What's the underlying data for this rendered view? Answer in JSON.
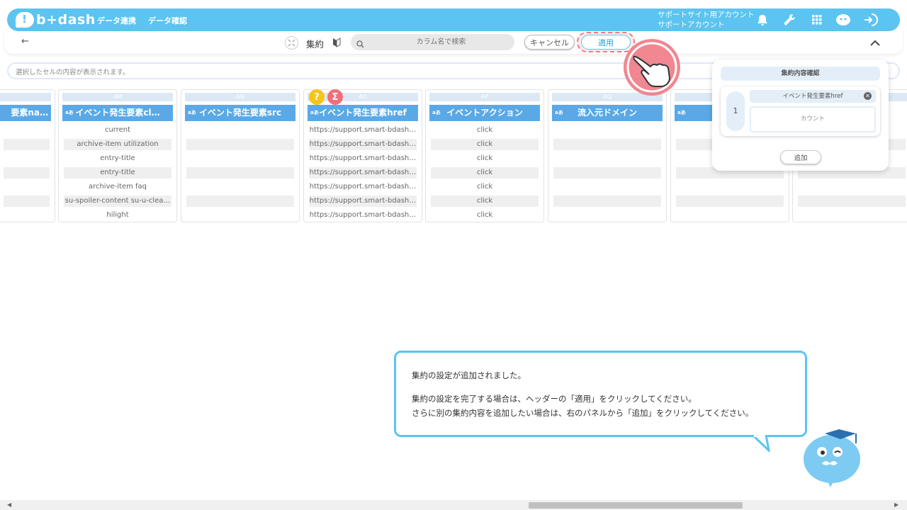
{
  "brand": {
    "logo_text": "b+dash"
  },
  "nav": {
    "links": [
      "データ連携",
      "データ確認"
    ],
    "account_line1": "サポートサイト用アカウント",
    "account_line2": "サポートアカウント"
  },
  "toolbar": {
    "back_glyph": "←",
    "aggregate_label": "集約",
    "search_placeholder": "カラム名で検索",
    "cancel_label": "キャンセル",
    "apply_label": "適用",
    "collapse_glyph": "^"
  },
  "cell_bar": {
    "text": "選択したセルの内容が表示されます。"
  },
  "columns": [
    {
      "letter": "",
      "type": "",
      "header": "要素na…",
      "cells": [
        "",
        "",
        "",
        "",
        "",
        "",
        ""
      ]
    },
    {
      "letter": "AM",
      "type": "aあ",
      "header": "イベント発生要素cl…",
      "cells": [
        "current",
        "archive-item utilization",
        "entry-title",
        "entry-title",
        "archive-item faq",
        "su-spoiler-content su-u-clea…",
        "hilight"
      ]
    },
    {
      "letter": "AN",
      "type": "aあ",
      "header": "イベント発生要素src",
      "cells": [
        "",
        "",
        "",
        "",
        "",
        "",
        ""
      ]
    },
    {
      "letter": "AO",
      "type": "aあ",
      "header": "イベント発生要素href",
      "cells": [
        "https://support.smart-bdash…",
        "https://support.smart-bdash…",
        "https://support.smart-bdash…",
        "https://support.smart-bdash…",
        "https://support.smart-bdash…",
        "https://support.smart-bdash…",
        "https://support.smart-bdash…"
      ]
    },
    {
      "letter": "AP",
      "type": "aあ",
      "header": "イベントアクション",
      "cells": [
        "click",
        "click",
        "click",
        "click",
        "click",
        "click",
        "click"
      ]
    },
    {
      "letter": "AQ",
      "type": "aあ",
      "header": "流入元ドメイン",
      "cells": [
        "",
        "",
        "",
        "",
        "",
        "",
        ""
      ]
    },
    {
      "letter": "",
      "type": "aあ",
      "header": "流",
      "cells": [
        "",
        "",
        "",
        "",
        "",
        "",
        ""
      ]
    },
    {
      "letter": "",
      "type": "",
      "header": "",
      "cells": [
        "",
        "",
        "",
        "",
        "",
        "",
        ""
      ]
    }
  ],
  "badges": {
    "key": "?",
    "sigma": "Σ"
  },
  "panel": {
    "title": "集約内容確認",
    "item_number": "1",
    "item_column": "イベント発生要素href",
    "item_function": "カウント",
    "add_label": "追加",
    "remove_glyph": "✕"
  },
  "tooltip": {
    "line1": "集約の設定が追加されました。",
    "line2": "集約の設定を完了する場合は、ヘッダーの「適用」をクリックしてください。",
    "line3": "さらに別の集約内容を追加したい場合は、右のパネルから「追加」をクリックしてください。"
  },
  "colors": {
    "accent": "#5bc4f0",
    "header_blue": "#5aa9e6",
    "highlight": "#ef7a85"
  }
}
